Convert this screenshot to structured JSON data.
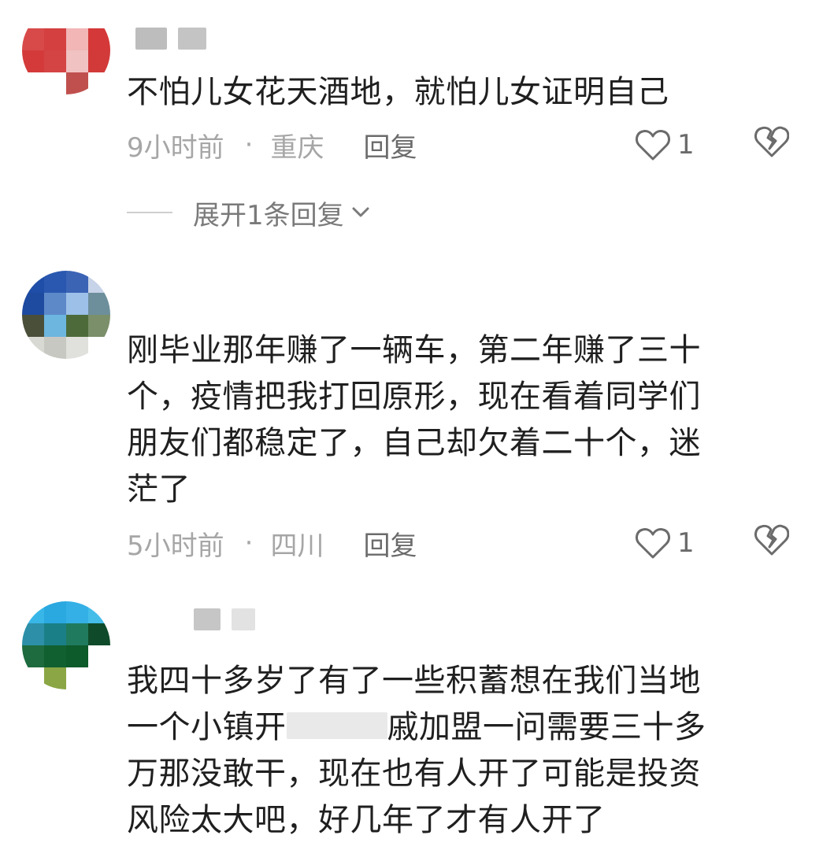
{
  "comments": [
    {
      "text": "不怕儿女花天酒地，就怕儿女证明自己",
      "time": "9小时前",
      "dot": "·",
      "location": "重庆",
      "reply_label": "回复",
      "likes": "1",
      "expand_label": "展开1条回复"
    },
    {
      "text_lines": [
        "刚毕业那年赚了一辆车，第二年赚了三十",
        "个，疫情把我打回原形，现在看着同学们",
        "朋友们都稳定了，自己却欠着二十个，迷",
        "茫了"
      ],
      "time": "5小时前",
      "dot": "·",
      "location": "四川",
      "reply_label": "回复",
      "likes": "1"
    },
    {
      "text_lines": [
        "我四十多岁了有了一些积蓄想在我们当地",
        "一个小镇开",
        "戚加盟一问需要三十多",
        "万那没敢干，现在也有人开了可能是投资",
        "风险太大吧，好几年了才有人开了"
      ]
    }
  ],
  "colors": {
    "text": "#1f1f1f",
    "meta": "#a6a6a6",
    "action": "#6b6b6b"
  },
  "icons": [
    "heart-outline-icon",
    "broken-heart-icon",
    "chevron-down-icon"
  ]
}
